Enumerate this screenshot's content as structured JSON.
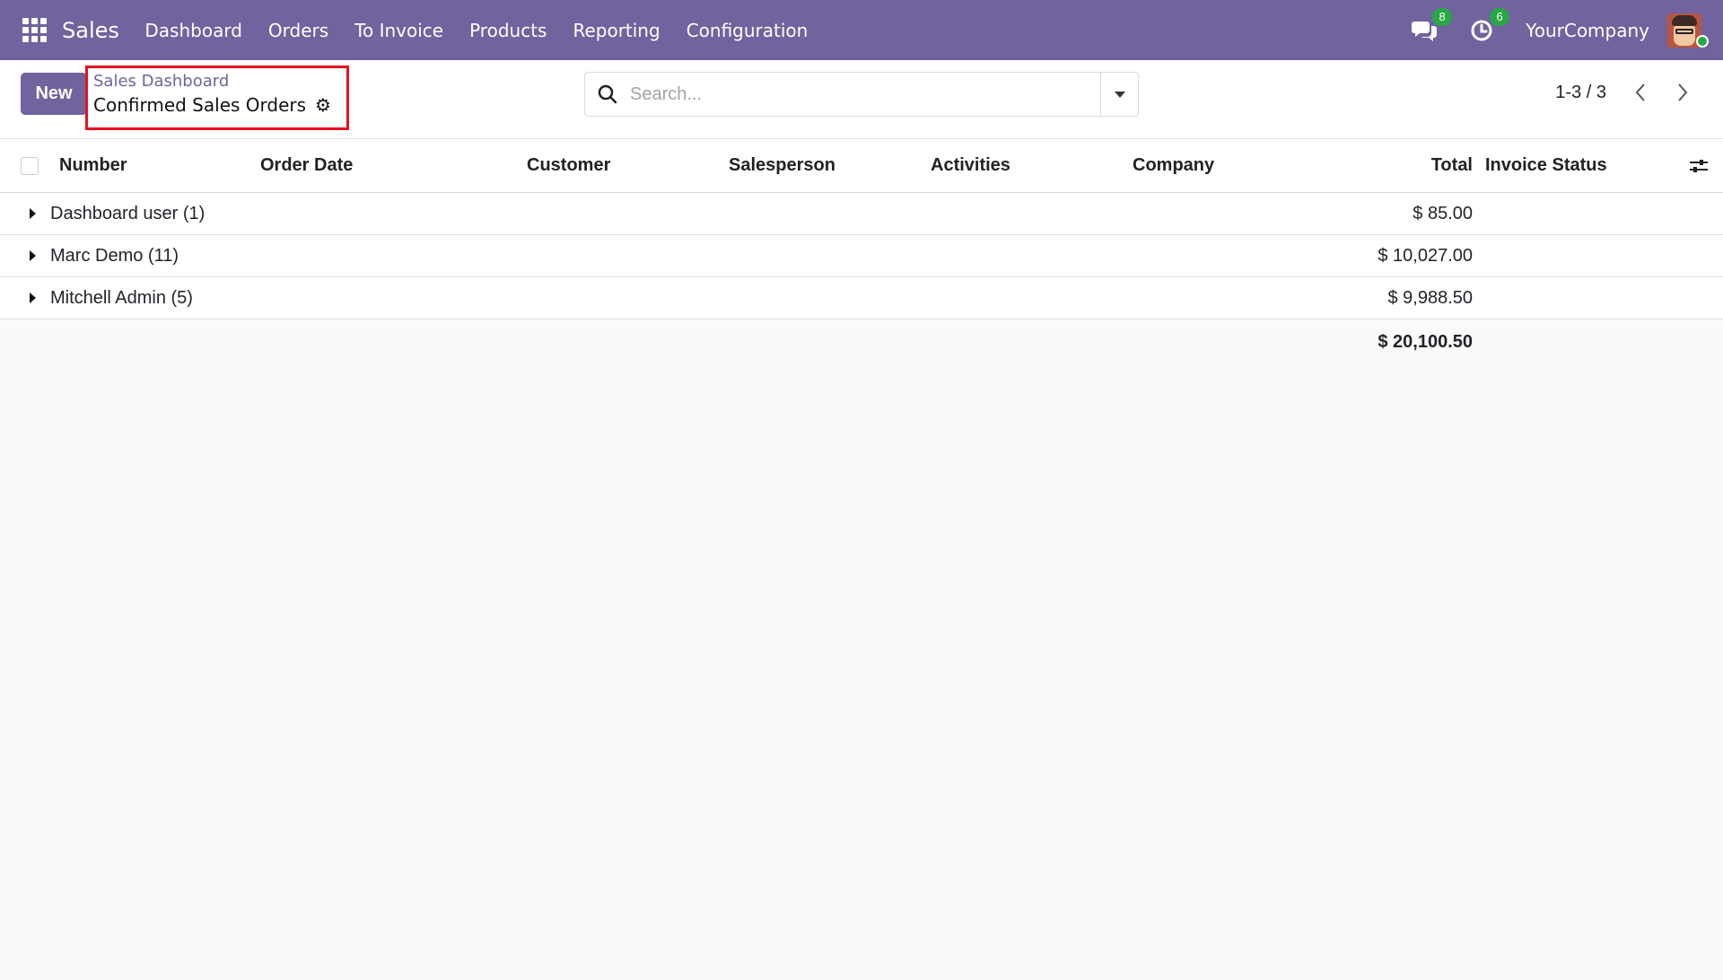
{
  "navbar": {
    "app_name": "Sales",
    "menu": [
      "Dashboard",
      "Orders",
      "To Invoice",
      "Products",
      "Reporting",
      "Configuration"
    ],
    "messages_count": "8",
    "activities_count": "6",
    "company": "YourCompany"
  },
  "control_panel": {
    "new_label": "New",
    "breadcrumb_parent": "Sales Dashboard",
    "breadcrumb_current": "Confirmed Sales Orders",
    "search_placeholder": "Search...",
    "pager": "1-3 / 3"
  },
  "list": {
    "columns": {
      "number": "Number",
      "order_date": "Order Date",
      "customer": "Customer",
      "salesperson": "Salesperson",
      "activities": "Activities",
      "company": "Company",
      "total": "Total",
      "invoice_status": "Invoice Status"
    },
    "groups": [
      {
        "label": "Dashboard user (1)",
        "total": "$ 85.00"
      },
      {
        "label": "Marc Demo (11)",
        "total": "$ 10,027.00"
      },
      {
        "label": "Mitchell Admin (5)",
        "total": "$ 9,988.50"
      }
    ],
    "grand_total": "$ 20,100.50"
  },
  "colors": {
    "brand": "#71639e",
    "badge": "#28a745",
    "highlight": "#e8101e"
  }
}
